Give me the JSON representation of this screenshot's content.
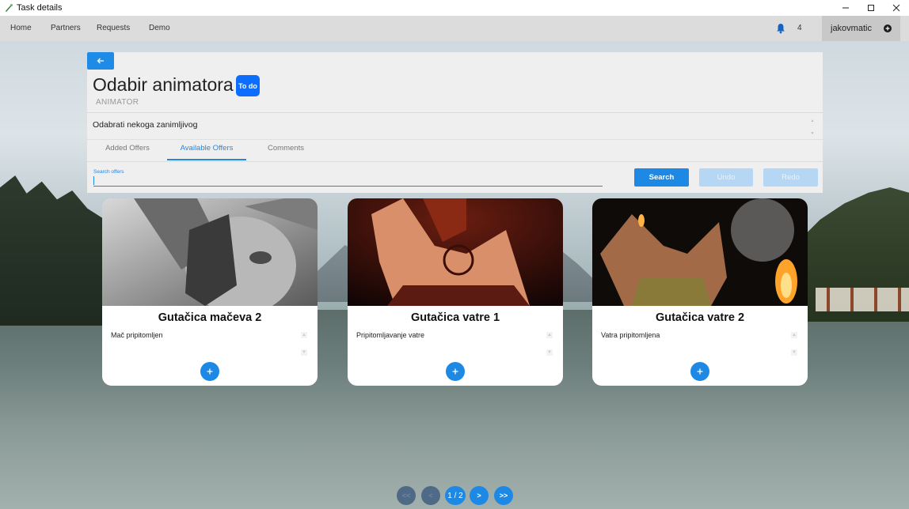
{
  "window": {
    "title": "Task details"
  },
  "nav": {
    "items": [
      {
        "label": "Home"
      },
      {
        "label": "Partners"
      },
      {
        "label": "Requests"
      },
      {
        "label": "Demo"
      }
    ],
    "notification_count": "4",
    "username": "jakovmatic"
  },
  "task": {
    "title": "Odabir animatora",
    "status": "To do",
    "type": "ANIMATOR",
    "description": "Odabrati nekoga zanimljivog"
  },
  "tabs": [
    {
      "label": "Added Offers",
      "active": false
    },
    {
      "label": "Available Offers",
      "active": true
    },
    {
      "label": "Comments",
      "active": false
    }
  ],
  "search": {
    "label": "Search offers",
    "value": "",
    "search_button": "Search",
    "undo_button": "Undo",
    "redo_button": "Redo"
  },
  "offers": [
    {
      "title": "Gutačica mačeva 2",
      "description": "Mač pripitomljen"
    },
    {
      "title": "Gutačica vatre 1",
      "description": "Pripitomljavanje vatre"
    },
    {
      "title": "Gutačica vatre 2",
      "description": "Vatra pripitomljena"
    }
  ],
  "pagination": {
    "first": "<<",
    "prev": "<",
    "current": "1 / 2",
    "next": ">",
    "last": ">>"
  },
  "colors": {
    "accent": "#1e88e5",
    "badge": "#0d6efd",
    "navbar": "#dcdcdc"
  }
}
